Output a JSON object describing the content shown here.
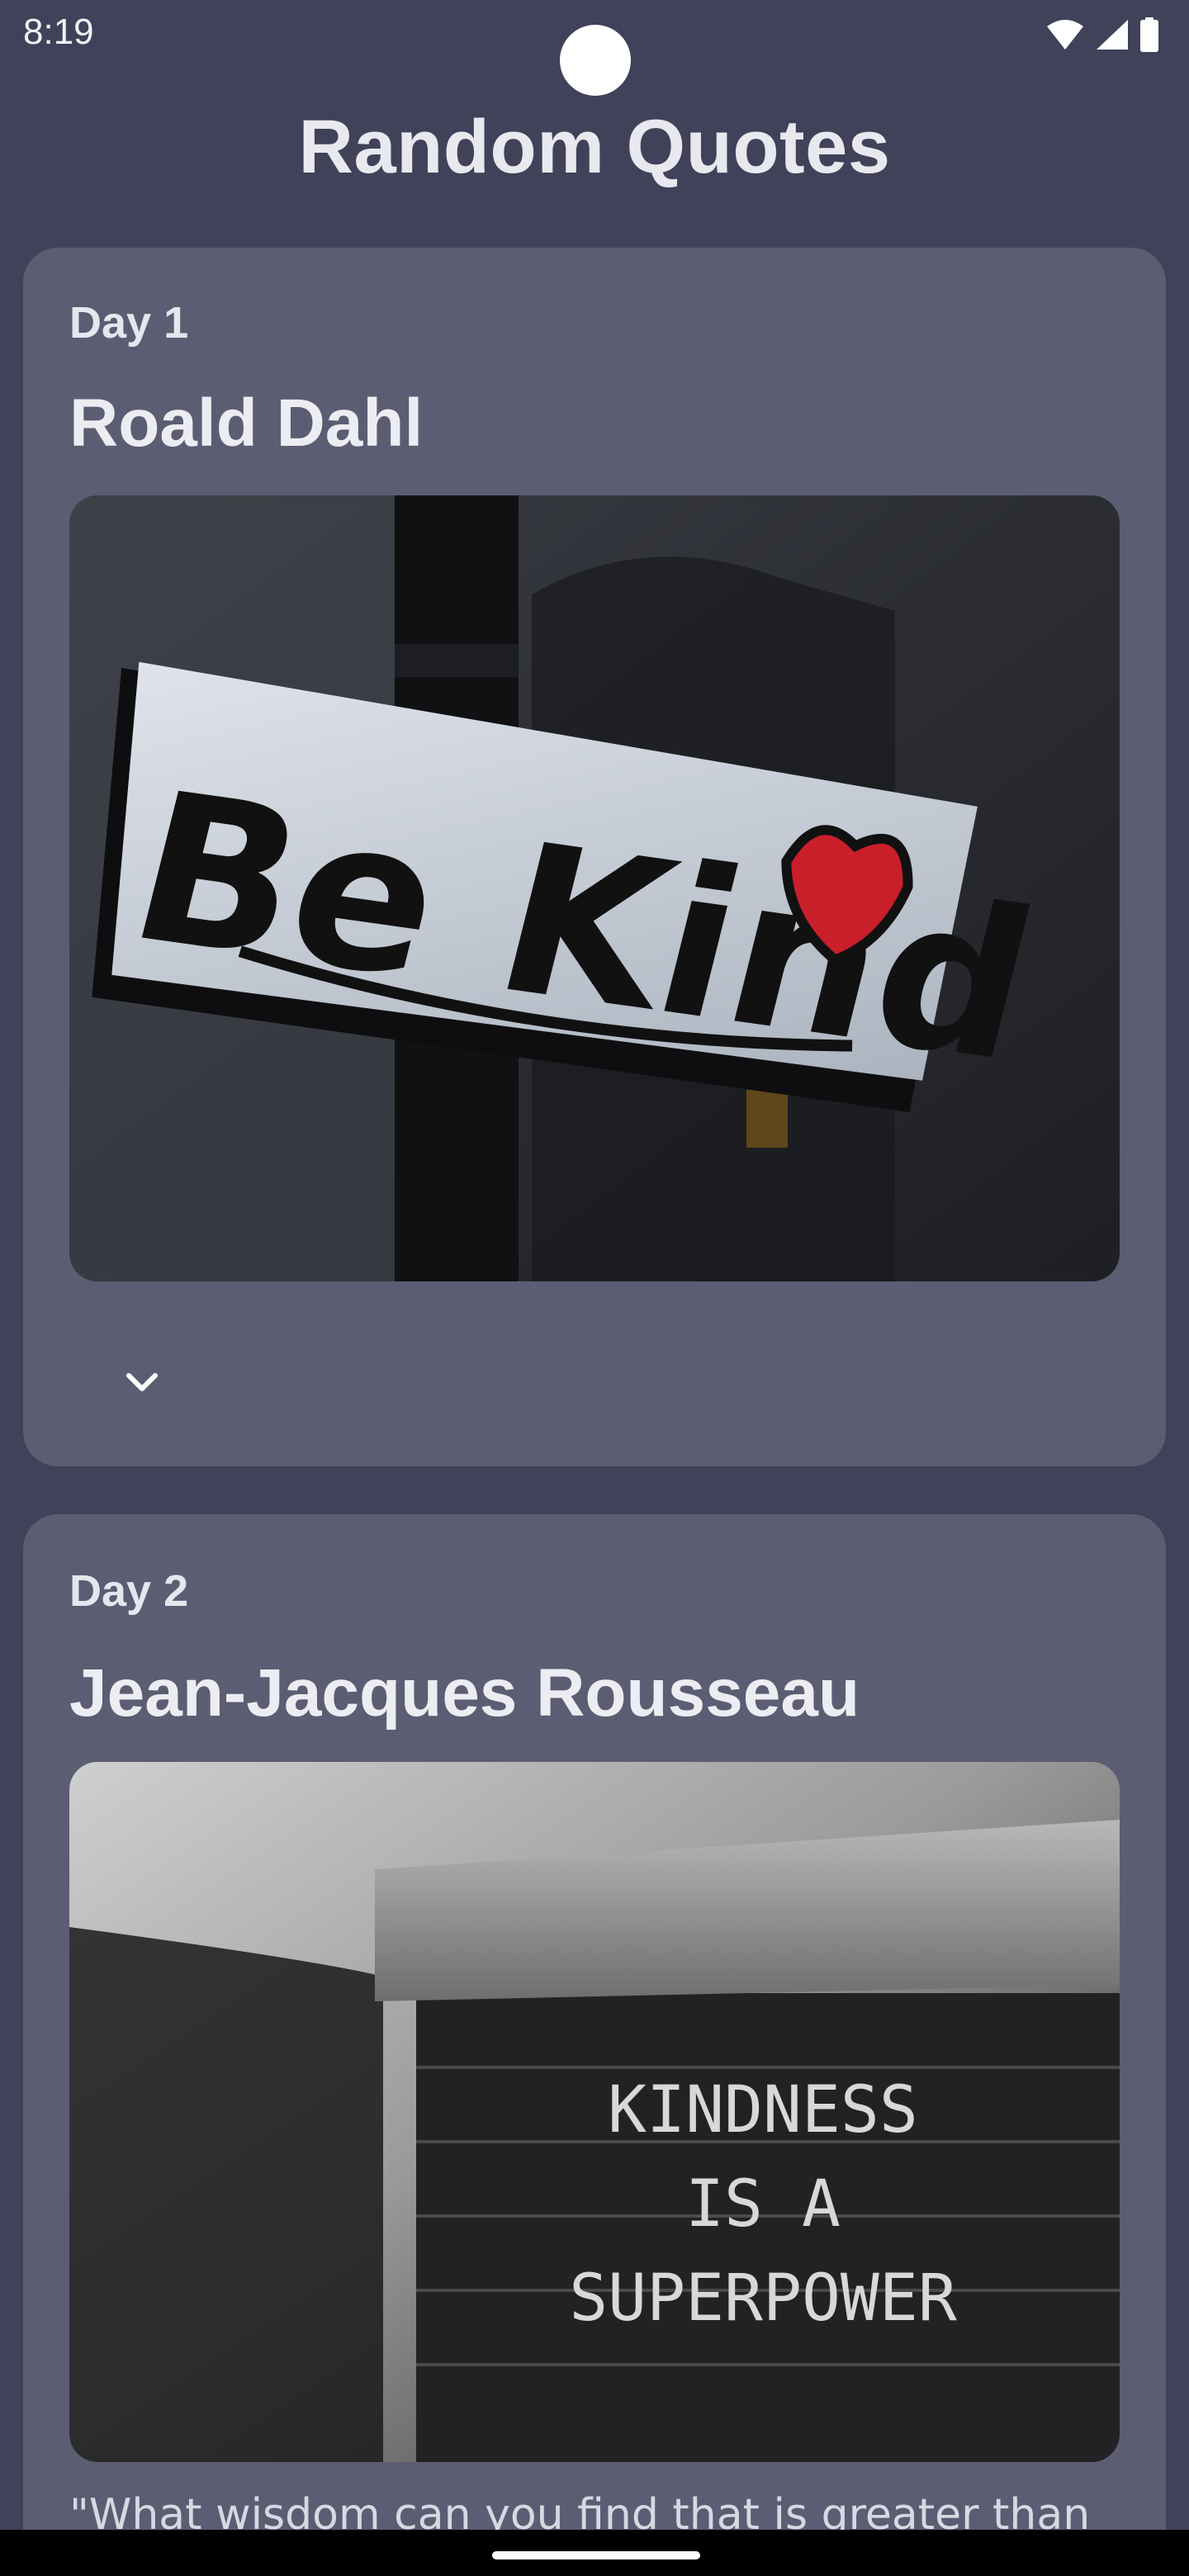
{
  "status_bar": {
    "time": "8:19",
    "icons": [
      "wifi-icon",
      "signal-icon",
      "battery-icon"
    ]
  },
  "app": {
    "title": "Random Quotes"
  },
  "cards": [
    {
      "day": "Day 1",
      "author": "Roald Dahl",
      "image_text": "Be Kind",
      "expand_icon": "chevron-down-icon"
    },
    {
      "day": "Day 2",
      "author": "Jean-Jacques Rousseau",
      "image_text": [
        "KINDNESS",
        "IS A",
        "SUPERPOWER"
      ],
      "quote": "\"What wisdom can you find that is greater than"
    }
  ],
  "colors": {
    "background": "#40425a",
    "card": "#5b5d73",
    "text": "#e6e6ee"
  }
}
